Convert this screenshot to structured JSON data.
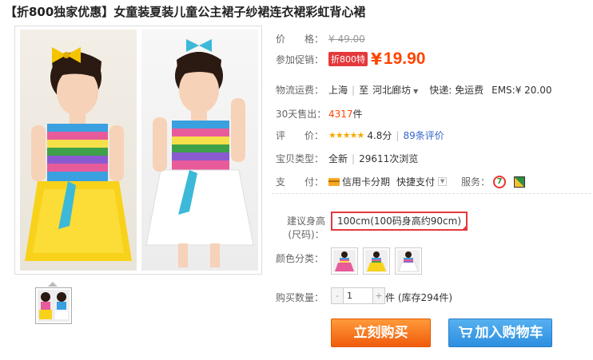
{
  "product": {
    "title": "【折800独家优惠】女童装夏装儿童公主裙子纱裙连衣裙彩虹背心裙"
  },
  "price": {
    "label": "价　　格：",
    "original": "¥ 49.00",
    "promo_label": "参加促销：",
    "promo_tag": "折800特",
    "currency": "¥",
    "value": "19.90"
  },
  "shipping": {
    "label": "物流运费：",
    "from": "上海",
    "sep": "|",
    "to_prefix": "至",
    "to": "河北廊坊",
    "express": "快递: 免运费",
    "ems": "EMS:¥ 20.00"
  },
  "sales": {
    "label": "30天售出：",
    "count": "4317",
    "unit": "件"
  },
  "rating": {
    "label": "评　　价：",
    "stars": "★★★★★",
    "score": "4.8分",
    "sep": "|",
    "reviews": "89条评价"
  },
  "item_type": {
    "label": "宝贝类型：",
    "condition": "全新",
    "sep": "|",
    "views": "29611次浏览"
  },
  "payment": {
    "label": "支　　付：",
    "credit": "信用卡分期",
    "quick": "快捷支付",
    "service_label": "服务："
  },
  "size": {
    "label_line1": "建议身高",
    "label_line2": "(尺码)：",
    "selected": "100cm(100码身高约90cm)"
  },
  "color": {
    "label": "颜色分类："
  },
  "quantity": {
    "label": "购买数量：",
    "minus": "-",
    "value": "1",
    "plus": "+",
    "stock": "件 (库存294件)"
  },
  "actions": {
    "buy": "立刻购买",
    "cart": "加入购物车"
  },
  "colors": {
    "price": "#ff4400",
    "promo_tag": "#e4393c",
    "buy_button": "#f05c0c",
    "cart_button": "#2d8fe0",
    "sales_count": "#ff4400"
  }
}
